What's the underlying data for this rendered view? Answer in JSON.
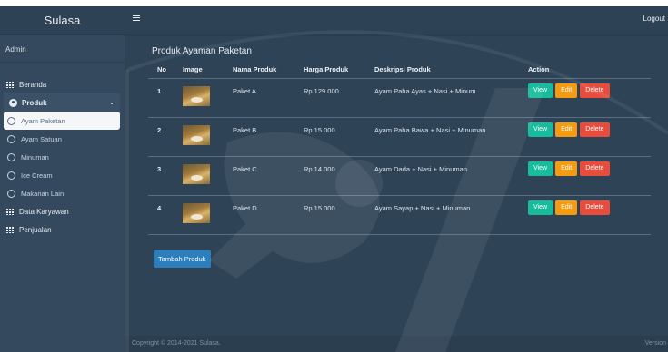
{
  "sidebar": {
    "brand": "Sulasa",
    "user": "Admin",
    "items": [
      {
        "label": "Beranda",
        "icon": "grid-icon"
      },
      {
        "label": "Produk",
        "icon": "gauge-icon",
        "expanded": true
      },
      {
        "label": "Data Karyawan",
        "icon": "grid-icon"
      },
      {
        "label": "Penjualan",
        "icon": "grid-icon"
      }
    ],
    "produk_sub": [
      {
        "label": "Ayam Paketan",
        "active": true
      },
      {
        "label": "Ayam Satuan"
      },
      {
        "label": "Minuman"
      },
      {
        "label": "Ice Cream"
      },
      {
        "label": "Makanan Lain"
      }
    ]
  },
  "topbar": {
    "menu_icon": "hamburger-icon",
    "logout": "Logout"
  },
  "main": {
    "title": "Produk Ayaman Paketan",
    "columns": [
      "No",
      "Image",
      "Nama Produk",
      "Harga Produk",
      "Deskripsi Produk",
      "Action"
    ],
    "rows": [
      {
        "no": "1",
        "nama": "Paket A",
        "harga": "Rp 129.000",
        "deskripsi": "Ayam Paha Ayas + Nasi + Minum"
      },
      {
        "no": "2",
        "nama": "Paket B",
        "harga": "Rp 15.000",
        "deskripsi": "Ayam Paha Bawa + Nasi + Minuman"
      },
      {
        "no": "3",
        "nama": "Paket C",
        "harga": "Rp 14.000",
        "deskripsi": "Ayam Dada + Nasi + Minuman"
      },
      {
        "no": "4",
        "nama": "Paket D",
        "harga": "Rp 15.000",
        "deskripsi": "Ayam Sayap + Nasi + Minuman"
      }
    ],
    "actions": {
      "view": "View",
      "edit": "Edit",
      "delete": "Delete"
    },
    "add_button": "Tambah Produk"
  },
  "footer": {
    "copyright": "Copyright © 2014-2021 Sulasa.",
    "version": "Version"
  },
  "colors": {
    "view": "#18bc9c",
    "edit": "#f39c12",
    "delete": "#e74c3c",
    "primary": "#2c7fbc"
  }
}
